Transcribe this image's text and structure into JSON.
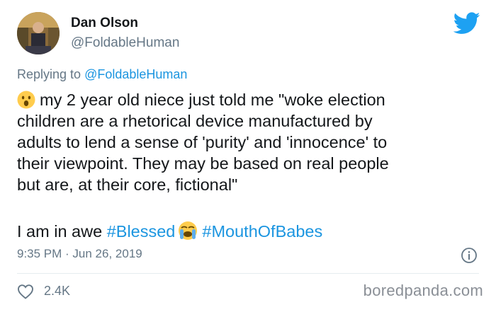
{
  "author": {
    "name": "Dan Olson",
    "handle": "@FoldableHuman"
  },
  "reply": {
    "prefix": "Replying to",
    "mention": "@FoldableHuman"
  },
  "tweet": {
    "lines": [
      "my 2 year old niece just told me \"woke election",
      "children are a rhetorical device manufactured by",
      "adults to lend a sense of 'purity' and 'innocence' to",
      "their viewpoint. They may be based on real people",
      "but are, at their core, fictional\""
    ],
    "second_para": {
      "text": "I am in awe",
      "hashtag1": "#Blessed",
      "hashtag2": "#MouthOfBabes"
    },
    "emojis": [
      "surprised-face-emoji",
      "loudly-crying-face-emoji"
    ]
  },
  "timestamp": "9:35 PM · Jun 26, 2019",
  "likes": "2.4K",
  "watermark": "boredpanda.com",
  "icons": [
    "twitter-bird-icon",
    "info-icon",
    "heart-icon"
  ],
  "colors": {
    "link": "#1b95e0",
    "secondary_text": "#657786",
    "primary_text": "#14171a",
    "twitter_blue": "#1da1f2"
  }
}
